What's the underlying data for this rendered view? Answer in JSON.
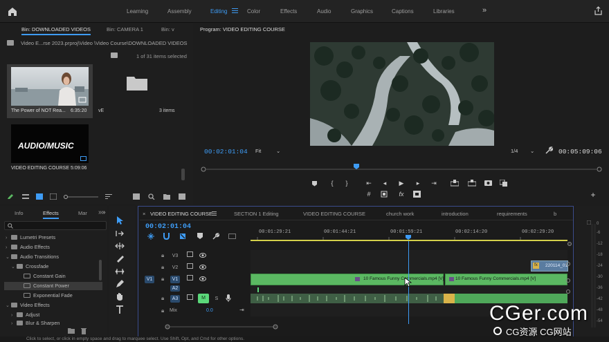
{
  "workspaces": [
    "Learning",
    "Assembly",
    "Editing",
    "Color",
    "Effects",
    "Audio",
    "Graphics",
    "Captions",
    "Libraries"
  ],
  "workspace_active": "Editing",
  "project_panel": {
    "tabs": [
      "Bin: DOWNLOADED VIDEOS",
      "Bin: CAMERA 1",
      "Bin: v"
    ],
    "path": "Video E...rse 2023.prproj\\Video \\Video Course\\DOWNLOADED VIDEOS",
    "selection": "1 of 31 items selected",
    "clips": [
      {
        "name": "The Power of NOT Rea...",
        "duration": "6:35:20"
      },
      {
        "name": "VIDEO EDITING COURSE",
        "duration": "5:09:06",
        "thumb_text": "AUDIO/MUSIC"
      }
    ],
    "folder": {
      "name": "vE",
      "count": "3 items"
    }
  },
  "program": {
    "title": "Program: VIDEO EDITING COURSE",
    "timecode_in": "00:02:01:04",
    "fit": "Fit",
    "resolution": "1/4",
    "timecode_out": "00:05:09:06"
  },
  "effects_panel": {
    "tabs": [
      "Info",
      "Effects",
      "Mar"
    ],
    "tree": [
      {
        "label": "Lumetri Presets",
        "type": "folder",
        "level": 0
      },
      {
        "label": "Audio Effects",
        "type": "folder",
        "level": 0
      },
      {
        "label": "Audio Transitions",
        "type": "folder",
        "level": 0,
        "open": true
      },
      {
        "label": "Crossfade",
        "type": "folder",
        "level": 1,
        "open": true
      },
      {
        "label": "Constant Gain",
        "type": "effect",
        "level": 2
      },
      {
        "label": "Constant Power",
        "type": "effect",
        "level": 2,
        "selected": true
      },
      {
        "label": "Exponential Fade",
        "type": "effect",
        "level": 2
      },
      {
        "label": "Video Effects",
        "type": "folder",
        "level": 0,
        "open": true
      },
      {
        "label": "Adjust",
        "type": "folder",
        "level": 1
      },
      {
        "label": "Blur & Sharpen",
        "type": "folder",
        "level": 1
      }
    ]
  },
  "timeline": {
    "tabs": [
      "VIDEO EDITING COURSE",
      "SECTION 1 Editing",
      "VIDEO EDITING COURSE",
      "church work",
      "introduction",
      "requirements",
      "b"
    ],
    "timecode": "00:02:01:04",
    "ruler": [
      "00:01:29:21",
      "00:01:44:21",
      "00:01:59:21",
      "00:02:14:20",
      "00:02:29:20"
    ],
    "tracks": {
      "v3": "V3",
      "v2": "V2",
      "v1": "V1",
      "src_v1": "V1",
      "a2": "A2",
      "a3": "A3",
      "mute": "M",
      "solo": "S",
      "mix_label": "Mix",
      "mix_value": "0.0"
    },
    "clip_v2": "220114_01",
    "clip_v1_a": "10 Famous Funny Commercials.mp4 [V]",
    "clip_v1_b": "10 Famous Funny Commercials.mp4 [V]"
  },
  "meter_labels": [
    "0",
    "-6",
    "-12",
    "-18",
    "-24",
    "-30",
    "-36",
    "-42",
    "-48",
    "-54"
  ],
  "status_bar": "Click to select, or click in empty space and drag to marquee select. Use Shift, Opt, and Cmd for other options.",
  "watermark": {
    "main": "CGer.com",
    "sub": "CG资源 CG网站"
  },
  "colors": {
    "accent": "#3e9cf5",
    "clip_green": "#5bb862",
    "label_blue": "#2a4a6c"
  }
}
